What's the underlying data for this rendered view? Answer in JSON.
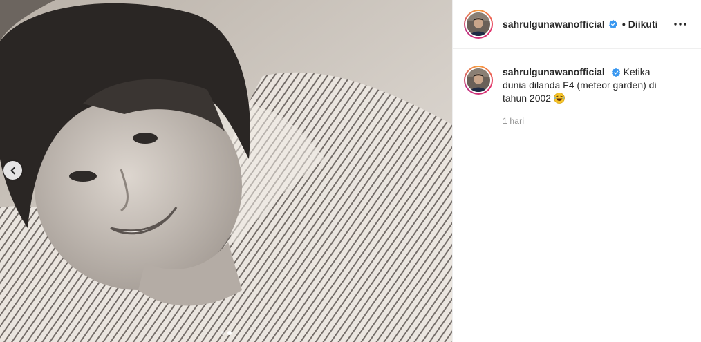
{
  "post": {
    "username": "sahrulgunawanofficial",
    "follow_separator": "•",
    "follow_state": "Diikuti",
    "caption": "Ketika dunia dilanda F4 (meteor garden) di tahun 2002",
    "caption_emoji": "laughing-with-tears-emoji",
    "timestamp": "1 hari"
  },
  "carousel": {
    "total": 2,
    "active_index": 2
  },
  "colors": {
    "verified": "#3897f0",
    "text": "#262626",
    "muted": "#8e8e8e"
  }
}
